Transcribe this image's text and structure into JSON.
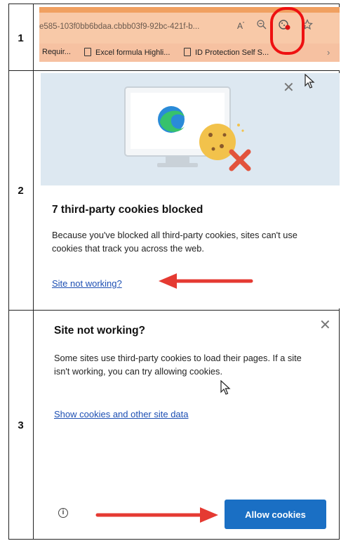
{
  "steps": {
    "one": "1",
    "two": "2",
    "three": "3"
  },
  "browser": {
    "url_fragment": "e585-103f0bb6bdaa.cbbb03f9-92bc-421f-b...",
    "read_aloud_icon": "read-aloud-icon",
    "zoom_icon": "zoom-icon",
    "tracking_icon": "tracking-prevention-icon",
    "favorites_icon": "favorites-icon",
    "favorites": [
      {
        "label": "Requir..."
      },
      {
        "label": "Excel formula Highli..."
      },
      {
        "label": "ID Protection Self S..."
      }
    ],
    "annotation_color": "#e11111"
  },
  "panel2": {
    "title": "7 third-party cookies blocked",
    "body": "Because you've blocked all third-party cookies, sites can't use cookies that track you across the web.",
    "link": "Site not working?",
    "close_icon": "close-icon",
    "illustration": "computer-with-blocked-cookie-illustration"
  },
  "panel3": {
    "title": "Site not working?",
    "body": "Some sites use third-party cookies to load their pages. If a site isn't working, you can try allowing cookies.",
    "link": "Show cookies and other site data",
    "button": "Allow cookies",
    "close_icon": "close-icon",
    "info_icon": "info-icon"
  },
  "colors": {
    "accent_blue": "#1a6fc4",
    "link_blue": "#1d4fb3",
    "arrow_red": "#e53a32"
  }
}
